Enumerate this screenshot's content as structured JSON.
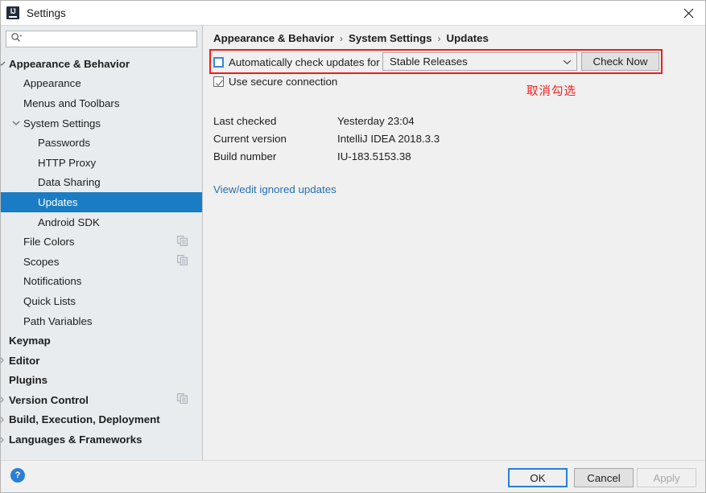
{
  "window": {
    "title": "Settings",
    "app_icon": "intellij-idea-icon",
    "close_icon": "close-icon"
  },
  "search": {
    "value": "",
    "placeholder": "",
    "icon": "search-icon",
    "dropdown_icon": "chevron-down-icon"
  },
  "sidebar": {
    "items": [
      {
        "label": "Appearance & Behavior",
        "indent": 0,
        "bold": true,
        "chevron": "down",
        "selected": false,
        "copy_icon": false
      },
      {
        "label": "Appearance",
        "indent": 1,
        "bold": false,
        "chevron": "none",
        "selected": false,
        "copy_icon": false
      },
      {
        "label": "Menus and Toolbars",
        "indent": 1,
        "bold": false,
        "chevron": "none",
        "selected": false,
        "copy_icon": false
      },
      {
        "label": "System Settings",
        "indent": 1,
        "bold": false,
        "chevron": "down",
        "selected": false,
        "copy_icon": false
      },
      {
        "label": "Passwords",
        "indent": 2,
        "bold": false,
        "chevron": "none",
        "selected": false,
        "copy_icon": false
      },
      {
        "label": "HTTP Proxy",
        "indent": 2,
        "bold": false,
        "chevron": "none",
        "selected": false,
        "copy_icon": false
      },
      {
        "label": "Data Sharing",
        "indent": 2,
        "bold": false,
        "chevron": "none",
        "selected": false,
        "copy_icon": false
      },
      {
        "label": "Updates",
        "indent": 2,
        "bold": false,
        "chevron": "none",
        "selected": true,
        "copy_icon": false
      },
      {
        "label": "Android SDK",
        "indent": 2,
        "bold": false,
        "chevron": "none",
        "selected": false,
        "copy_icon": false
      },
      {
        "label": "File Colors",
        "indent": 1,
        "bold": false,
        "chevron": "none",
        "selected": false,
        "copy_icon": true
      },
      {
        "label": "Scopes",
        "indent": 1,
        "bold": false,
        "chevron": "none",
        "selected": false,
        "copy_icon": true
      },
      {
        "label": "Notifications",
        "indent": 1,
        "bold": false,
        "chevron": "none",
        "selected": false,
        "copy_icon": false
      },
      {
        "label": "Quick Lists",
        "indent": 1,
        "bold": false,
        "chevron": "none",
        "selected": false,
        "copy_icon": false
      },
      {
        "label": "Path Variables",
        "indent": 1,
        "bold": false,
        "chevron": "none",
        "selected": false,
        "copy_icon": false
      },
      {
        "label": "Keymap",
        "indent": 0,
        "bold": true,
        "chevron": "none",
        "selected": false,
        "copy_icon": false
      },
      {
        "label": "Editor",
        "indent": 0,
        "bold": true,
        "chevron": "right",
        "selected": false,
        "copy_icon": false
      },
      {
        "label": "Plugins",
        "indent": 0,
        "bold": true,
        "chevron": "none",
        "selected": false,
        "copy_icon": false
      },
      {
        "label": "Version Control",
        "indent": 0,
        "bold": true,
        "chevron": "right",
        "selected": false,
        "copy_icon": true
      },
      {
        "label": "Build, Execution, Deployment",
        "indent": 0,
        "bold": true,
        "chevron": "right",
        "selected": false,
        "copy_icon": false
      },
      {
        "label": "Languages & Frameworks",
        "indent": 0,
        "bold": true,
        "chevron": "right",
        "selected": false,
        "copy_icon": false
      }
    ]
  },
  "content": {
    "breadcrumb": [
      "Appearance & Behavior",
      "System Settings",
      "Updates"
    ],
    "breadcrumb_separator": "›",
    "auto_check": {
      "label": "Automatically check updates for",
      "checked": false,
      "focused": true
    },
    "channel": {
      "value": "Stable Releases",
      "arrow_icon": "chevron-down-icon"
    },
    "check_now_label": "Check Now",
    "secure_connection": {
      "label": "Use secure connection",
      "checked": true
    },
    "annotation": {
      "text": "取消勾选",
      "color": "#f32020"
    },
    "info": [
      {
        "key": "Last checked",
        "value": "Yesterday 23:04"
      },
      {
        "key": "Current version",
        "value": "IntelliJ IDEA 2018.3.3"
      },
      {
        "key": "Build number",
        "value": "IU-183.5153.38"
      }
    ],
    "ignored_updates_link": "View/edit ignored updates"
  },
  "footer": {
    "help_label": "?",
    "ok_label": "OK",
    "cancel_label": "Cancel",
    "apply_label": "Apply"
  },
  "colors": {
    "selection": "#1a7dc4",
    "link": "#2470b3",
    "annotation": "#f61a18",
    "sidebar_bg": "#e8ecef",
    "content_bg": "#f0f0f0"
  }
}
